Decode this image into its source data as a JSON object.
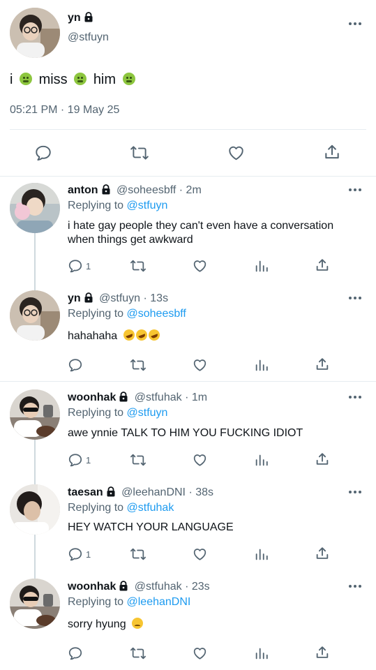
{
  "main_tweet": {
    "name": "yn",
    "handle": "@stfuyn",
    "text_parts": [
      "i",
      "miss",
      "him"
    ],
    "timestamp": "05:21 PM · 19 May 25"
  },
  "replies": [
    {
      "name": "anton",
      "handle": "@soheesbff · 2m",
      "replying_prefix": "Replying to ",
      "replying_to": "@stfuyn",
      "text": "i hate gay people they can't even have a conversation when things get awkward",
      "reply_count": "1"
    },
    {
      "name": "yn",
      "handle": "@stfuyn · 13s",
      "replying_prefix": "Replying to ",
      "replying_to": "@soheesbff",
      "text": "hahahaha",
      "reply_count": ""
    },
    {
      "name": "woonhak",
      "handle": "@stfuhak · 1m",
      "replying_prefix": "Replying to ",
      "replying_to": "@stfuyn",
      "text": "awe ynnie TALK TO HIM YOU FUCKING IDIOT",
      "reply_count": "1"
    },
    {
      "name": "taesan",
      "handle": "@leehanDNI · 38s",
      "replying_prefix": "Replying to ",
      "replying_to": "@stfuhak",
      "text": "HEY WATCH YOUR LANGUAGE",
      "reply_count": "1"
    },
    {
      "name": "woonhak",
      "handle": "@stfuhak · 23s",
      "replying_prefix": "Replying to ",
      "replying_to": "@leehanDNI",
      "text": "sorry hyung",
      "reply_count": ""
    }
  ],
  "icons": [
    "reply-icon",
    "retweet-icon",
    "like-icon",
    "share-icon",
    "analytics-icon",
    "lock-icon",
    "more-icon"
  ],
  "colors": {
    "text": "#0f1419",
    "secondary": "#536471",
    "link": "#1d9bf0",
    "divider": "#e6ecf0"
  }
}
